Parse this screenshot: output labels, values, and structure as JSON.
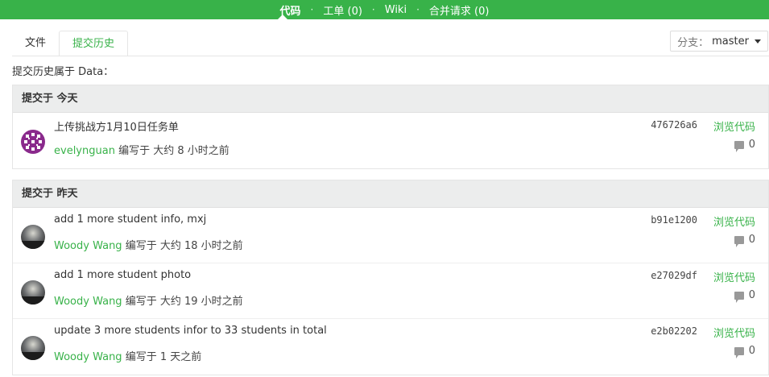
{
  "nav": {
    "items": [
      {
        "label": "代码",
        "active": true
      },
      {
        "label": "工单 (0)",
        "active": false
      },
      {
        "label": "Wiki",
        "active": false
      },
      {
        "label": "合并请求 (0)",
        "active": false
      }
    ],
    "separator": "·"
  },
  "tabs": [
    {
      "label": "文件",
      "active": false
    },
    {
      "label": "提交历史",
      "active": true
    }
  ],
  "branch": {
    "label": "分支：",
    "value": "master"
  },
  "history_title": "提交历史属于 Data：",
  "groups": [
    {
      "title": "提交于 今天",
      "commits": [
        {
          "message": "上传挑战方1月10日任务单",
          "author": "evelynguan",
          "rest": " 编写于 大约 8 小时之前",
          "sha": "476726a6",
          "browse": "浏览代码",
          "comments": "0",
          "avatar": "pattern-avatar"
        }
      ]
    },
    {
      "title": "提交于 昨天",
      "commits": [
        {
          "message": "add 1 more student info, mxj",
          "author": "Woody Wang",
          "rest": " 编写于 大约 18 小时之前",
          "sha": "b91e1200",
          "browse": "浏览代码",
          "comments": "0",
          "avatar": "sky-avatar"
        },
        {
          "message": "add 1 more student photo",
          "author": "Woody Wang",
          "rest": " 编写于 大约 19 小时之前",
          "sha": "e27029df",
          "browse": "浏览代码",
          "comments": "0",
          "avatar": "sky-avatar"
        },
        {
          "message": "update 3 more students infor to 33 students in total",
          "author": "Woody Wang",
          "rest": " 编写于 1 天之前",
          "sha": "e2b02202",
          "browse": "浏览代码",
          "comments": "0",
          "avatar": "sky-avatar"
        }
      ]
    }
  ],
  "colors": {
    "accent": "#38b249",
    "header_bg": "#eceded"
  }
}
